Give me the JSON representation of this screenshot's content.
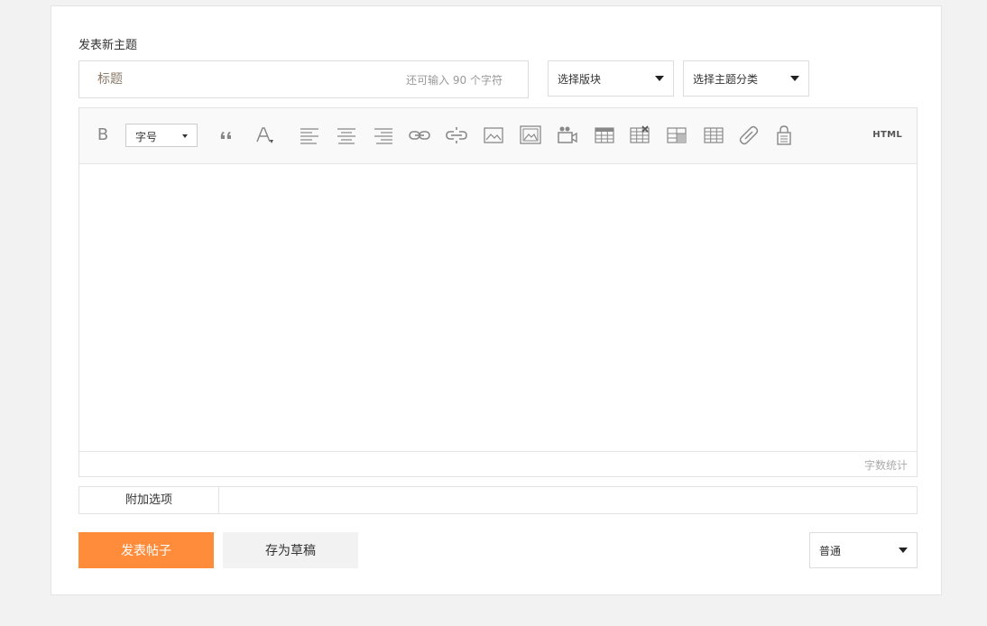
{
  "page": {
    "title": "发表新主题"
  },
  "title_input": {
    "placeholder": "标题",
    "value": "",
    "remaining": "还可输入 90 个字符"
  },
  "selects": {
    "forum": "选择版块",
    "category": "选择主题分类",
    "post_type": "普通"
  },
  "toolbar": {
    "bold": "B",
    "font_size": "字号",
    "html": "HTML",
    "icons": [
      "quote-icon",
      "font-color-icon",
      "align-left-icon",
      "align-center-icon",
      "align-right-icon",
      "link-icon",
      "unlink-icon",
      "image-icon",
      "attach-image-icon",
      "video-icon",
      "table-icon",
      "delete-table-icon",
      "merge-cells-icon",
      "split-cells-icon",
      "attachment-icon",
      "hide-content-icon"
    ]
  },
  "editor": {
    "word_count": "字数统计"
  },
  "extra": {
    "tab_label": "附加选项"
  },
  "actions": {
    "submit": "发表帖子",
    "save_draft": "存为草稿"
  },
  "colors": {
    "accent": "#ff8c3a",
    "border": "#dddddd",
    "toolbar_bg": "#f9f9f9"
  }
}
